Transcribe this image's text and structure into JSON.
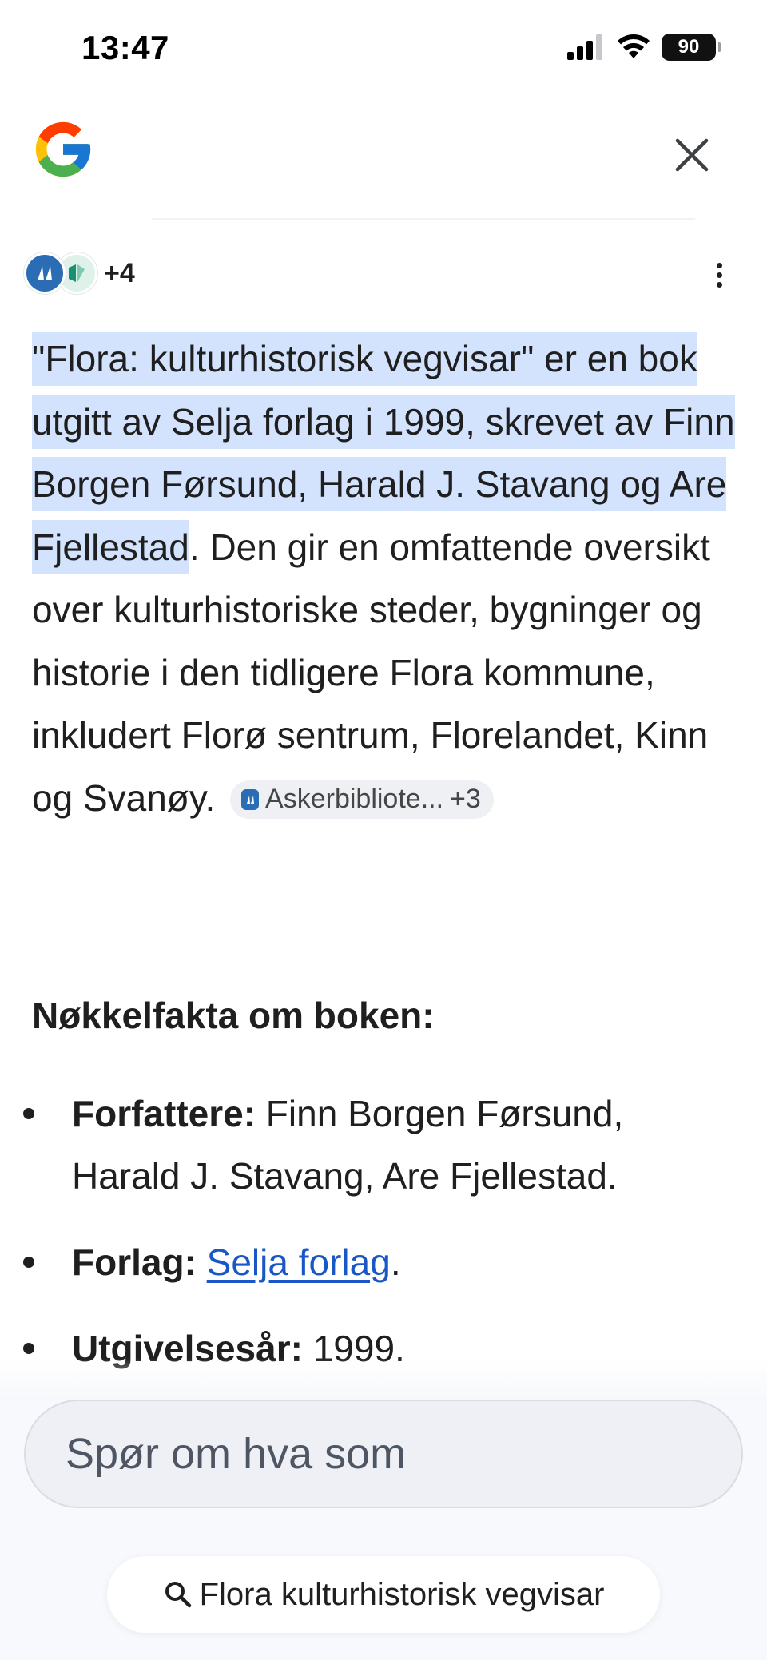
{
  "status_bar": {
    "time": "13:47",
    "battery": "90"
  },
  "header": {
    "logo": "google-logo",
    "close_icon": "close-icon"
  },
  "sources": {
    "extra_count": "+4"
  },
  "answer": {
    "highlighted": "\"Flora: kulturhistorisk vegvisar\" er en bok utgitt av Selja forlag i 1999, skrevet av Finn Borgen Førsund, Harald J. Stavang og Are Fjellestad",
    "period": ".",
    "body": "Den gir en omfattende oversikt over kulturhistoriske steder, bygninger og historie i den tidligere Flora kommune, inkludert Florø sentrum, Florelandet, Kinn og Svanøy.",
    "citation": {
      "source": "Askerbibliote...",
      "more": "+3"
    }
  },
  "facts": {
    "title": "Nøkkelfakta om boken:",
    "items": [
      {
        "label": "Forfattere:",
        "value": " Finn Borgen Førsund, Harald J. Stavang, Are Fjellestad."
      },
      {
        "label": "Forlag:",
        "link": "Selja forlag",
        "after": "."
      },
      {
        "label": "Utgivelsesår:",
        "value": " 1999."
      }
    ]
  },
  "ask": {
    "placeholder": "Spør om hva som"
  },
  "query": {
    "text": "Flora kulturhistorisk vegvisar"
  },
  "colors": {
    "highlight": "#d3e3fd",
    "link": "#1a57c6"
  }
}
